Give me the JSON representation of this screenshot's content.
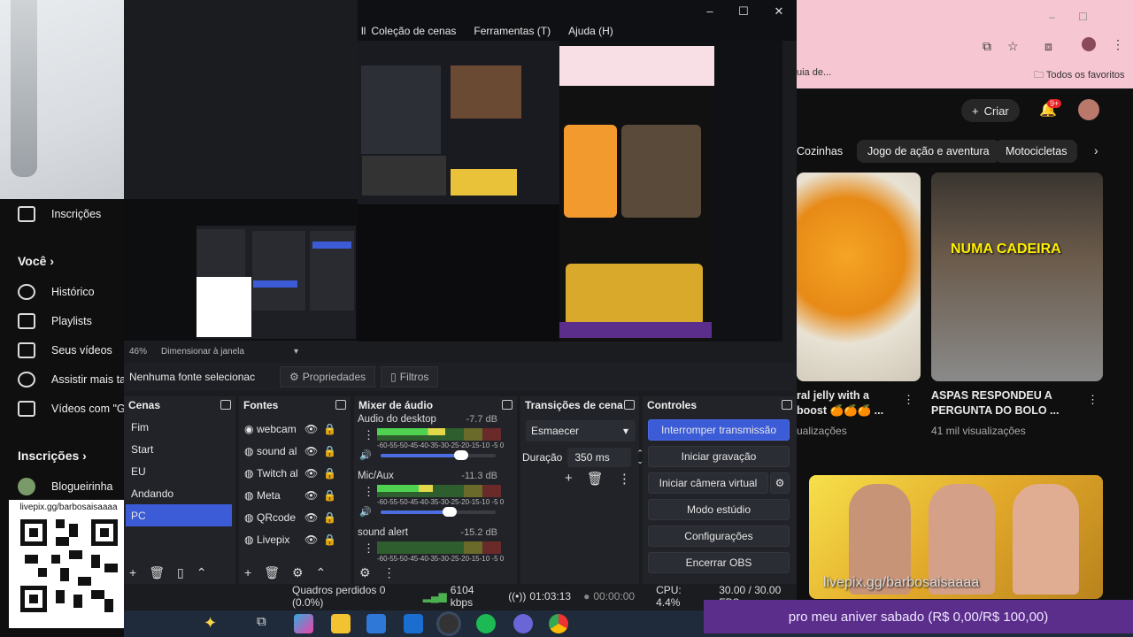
{
  "obs": {
    "menu": [
      "Coleção de cenas",
      "Ferramentas (T)",
      "Ajuda (H)"
    ],
    "menu_prefix": "ll",
    "zoom": "46%",
    "zoom_label": "Dimensionar à janela",
    "no_source": "Nenhuma fonte selecionac",
    "properties": "Propriedades",
    "filters": "Filtros",
    "scenes_title": "Cenas",
    "scenes": [
      "Fim",
      "Start",
      "EU",
      "Andando",
      "PC"
    ],
    "sources_title": "Fontes",
    "sources": [
      "webcam",
      "sound al",
      "Twitch al",
      "Meta",
      "QRcode",
      "Livepix"
    ],
    "mixer_title": "Mixer de áudio",
    "mixer": [
      {
        "name": "Audio do desktop",
        "db": "-7.7 dB",
        "level": 0.55,
        "volume": 0.7
      },
      {
        "name": "Mic/Aux",
        "db": "-11.3 dB",
        "level": 0.45,
        "volume": 0.6
      },
      {
        "name": "sound alert",
        "db": "-15.2 dB",
        "level": 0.0,
        "volume": 0.0
      }
    ],
    "meter_ticks": "-60-55-50-45-40-35-30-25-20-15-10 -5 0",
    "transitions_title": "Transições de cena",
    "transition": "Esmaecer",
    "duration_label": "Duração",
    "duration_value": "350 ms",
    "controls_title": "Controles",
    "controls": [
      "Interromper transmissão",
      "Iniciar gravação",
      "Iniciar câmera virtual",
      "Modo estúdio",
      "Configurações",
      "Encerrar OBS"
    ],
    "status": {
      "dropped": "Quadros perdidos 0 (0.0%)",
      "bitrate": "6104 kbps",
      "stream_time": "01:03:13",
      "rec_time": "00:00:00",
      "cpu": "CPU: 4.4%",
      "fps": "30.00 / 30.00 FPS"
    }
  },
  "yt_left": {
    "inscricoes_top": "Inscrições",
    "voce": "Você",
    "items": [
      "Histórico",
      "Playlists",
      "Seus vídeos",
      "Assistir mais ta",
      "Vídeos com \"G"
    ],
    "inscricoes": "Inscrições",
    "channel": "Blogueirinha"
  },
  "qr_label": "livepix.gg/barbosaisaaaa",
  "yt_right": {
    "tab_text": "uia de...",
    "bookmarks": "Todos os favoritos",
    "create": "Criar",
    "notif": "9+",
    "chips": [
      "Cozinhas",
      "Jogo de ação e aventura",
      "Motocicletas"
    ],
    "video1_title": "ral jelly with a boost 🍊🍊🍊 ...",
    "video1_meta": "ualizações",
    "video2_title": "ASPAS RESPONDEU A PERGUNTA DO BOLO ...",
    "video2_meta": "41 mil visualizações",
    "chair_text": "NUMA CADEIRA"
  },
  "overlay": {
    "livepix": "livepix.gg/barbosaisaaaa",
    "donation": "pro meu aniver sabado (R$ 0,00/R$ 100,00)"
  },
  "colors": {
    "obs_accent": "#3b5bd7",
    "donation_bg": "#5b2e8c"
  }
}
